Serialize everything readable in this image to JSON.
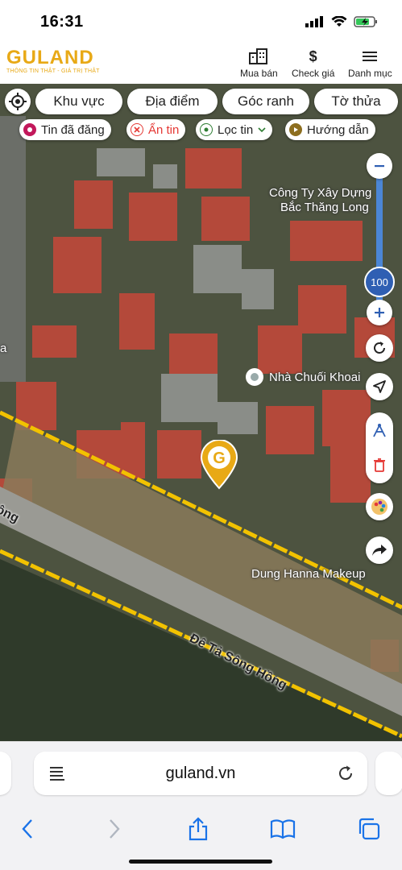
{
  "status": {
    "time": "16:31"
  },
  "header": {
    "logo_text": "GULAND",
    "logo_tagline": "THÔNG TIN THẬT - GIÁ TRỊ THẬT",
    "nav": [
      {
        "label": "Mua bán",
        "icon": "buildings-icon"
      },
      {
        "label": "Check giá",
        "icon": "dollar-icon"
      },
      {
        "label": "Danh mục",
        "icon": "menu-icon"
      }
    ]
  },
  "filters": {
    "row1": [
      "Khu vực",
      "Địa điểm",
      "Góc ranh",
      "Tờ thửa"
    ],
    "row2": [
      {
        "label": "Tin đã đăng",
        "icon": "posted-icon",
        "color": "#c2185b"
      },
      {
        "label": "Ẩn tin",
        "icon": "hide-icon",
        "color": "#e53935"
      },
      {
        "label": "Lọc tin",
        "icon": "filter-pin-icon",
        "color": "#2e7d32"
      },
      {
        "label": "Hướng dẫn",
        "icon": "play-guide-icon",
        "color": "#8d6e1f"
      }
    ]
  },
  "zoom": {
    "value": "100",
    "level_fraction": 0.7
  },
  "map": {
    "pois": [
      "Công Ty Xây Dựng",
      "Bắc Thăng Long",
      "Nhà Chuối Khoai",
      "Dung Hanna Makeup"
    ],
    "roads": [
      "Đê Tả Sông Hồng",
      "ông"
    ],
    "edge_label": "a"
  },
  "browser": {
    "url": "guland.vn"
  },
  "colors": {
    "brand": "#e8a916",
    "accent_blue": "#2f5fb3",
    "boundary": "#f2c200"
  }
}
